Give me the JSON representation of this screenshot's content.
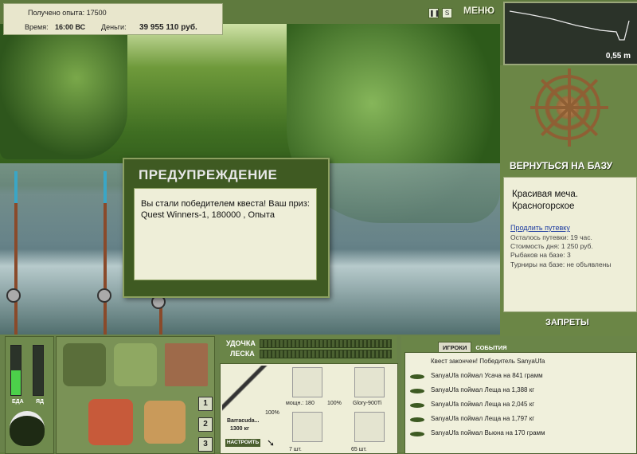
{
  "hud": {
    "exp_label": "Получено опыта: 17500",
    "time_label": "Время:",
    "time_value": "16:00 ВС",
    "money_label": "Деньги:",
    "money_value": "39 955 110 руб.",
    "menu_label": "МЕНЮ",
    "depth_value": "0,55 m"
  },
  "dialog": {
    "title": "ПРЕДУПРЕЖДЕНИЕ",
    "message": "Вы стали победителем квеста! Ваш приз: Quest Winners-1, 180000 , Опыта"
  },
  "base": {
    "return_label": "ВЕРНУТЬСЯ НА БАЗУ",
    "location_name": "Красивая меча. Красногорское",
    "extend_link": "Продлить путевку",
    "info_lines": [
      "Осталось путевки: 19 час.",
      "Стоимость дня: 1 250 руб.",
      "Рыбаков на базе: 3",
      "Турниры на базе: не объявлены"
    ],
    "bans_label": "ЗАПРЕТЫ"
  },
  "gauges": {
    "food_label": "ЕДА",
    "poison_label": "ЯД",
    "food_level": 0.5,
    "poison_level": 0.0
  },
  "inventory": {
    "page_buttons": [
      "1",
      "2",
      "3"
    ]
  },
  "gear": {
    "rod_label": "УДОЧКА",
    "line_label": "ЛЕСКА",
    "rod_name": "Barracuda...",
    "rod_weight": "1300 кг",
    "rod_percent": "100%",
    "setup_label": "НАСТРОИТЬ",
    "reel_power": "мощн.: 180",
    "reel_percent": "100%",
    "line_name": "Glory-900Ti",
    "hook_count": "7 шт.",
    "bait_count": "65 шт."
  },
  "events": {
    "tab_players": "ИГРОКИ",
    "tab_events": "СОБЫТИЯ",
    "items": [
      "Квест закончен! Победитель SanyaUfa",
      "SanyaUfa поймал Усача на 841 грамм",
      "SanyaUfa поймал Леща на 1,388 кг",
      "SanyaUfa поймал Леща на 2,045 кг",
      "SanyaUfa поймал Леща на 1,797 кг",
      "SanyaUfa поймал Вьюна на 170 грамм"
    ]
  },
  "colors": {
    "panel_green": "#5f7a3e",
    "cream": "#eeeed8",
    "gauge_green": "#4cd04a"
  }
}
